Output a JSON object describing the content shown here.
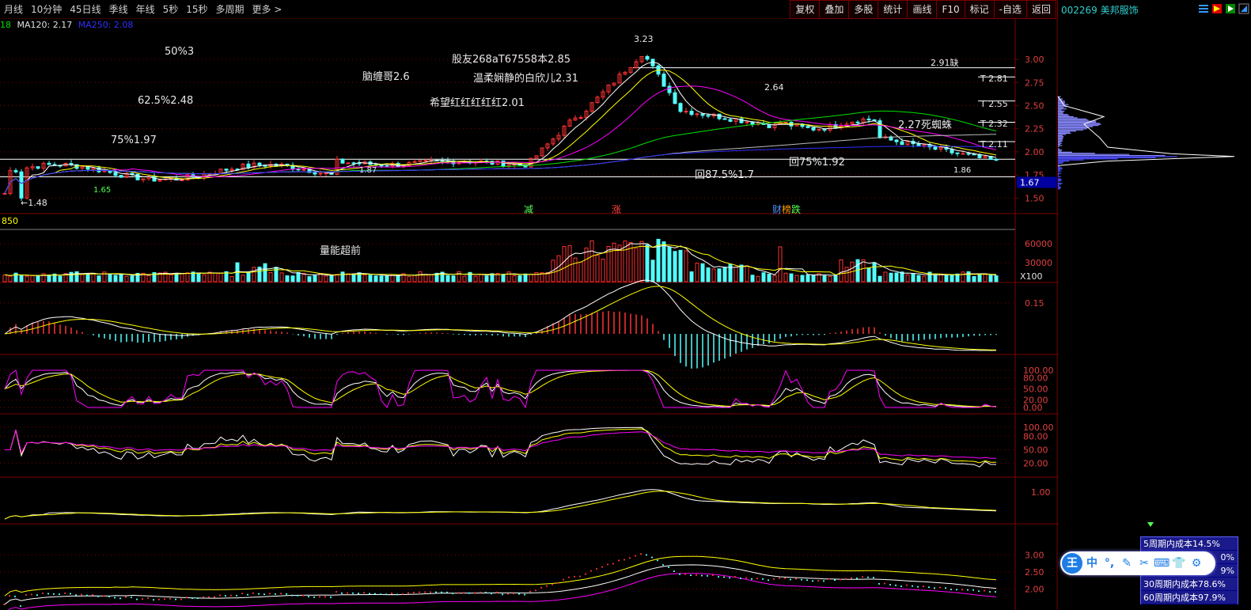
{
  "topbar": {
    "periods": [
      "月线",
      "10分钟",
      "45日线",
      "季线",
      "年线",
      "5秒",
      "15秒",
      "多周期",
      "更多 >"
    ],
    "buttons": [
      "复权",
      "叠加",
      "多股",
      "统计",
      "画线",
      "F10",
      "标记",
      "-自选",
      "返回"
    ]
  },
  "stock": {
    "code_name": "002269 美邦服饰"
  },
  "ma_legend": {
    "p1": "18",
    "p2": "MA120: 2.17",
    "p3": "MA250: 2.08"
  },
  "volume_label": "850",
  "x100": "X100",
  "price_axis": [
    "3.00",
    "2.75",
    "2.50",
    "2.25",
    "2.00",
    "1.75",
    "1.50"
  ],
  "current_price_tag": "1.67",
  "volume_axis": [
    "60000",
    "30000"
  ],
  "macd_axis": [
    "0.15"
  ],
  "kdj_axis": [
    "100.00",
    "80.00",
    "50.00",
    "20.00",
    "0.00"
  ],
  "rsi_axis": [
    "100.00",
    "80.00",
    "50.00",
    "20.00"
  ],
  "ind5_axis": [
    "1.00"
  ],
  "ind6_axis": [
    "3.00",
    "2.50",
    "2.00"
  ],
  "annotations": {
    "a1": "50%3",
    "a2": "62.5%2.48",
    "a3": "75%1.97",
    "a4": "脑缠哥2.6",
    "a5": "股友268aT67558本2.85",
    "a6": "温柔娴静的白欣儿2.31",
    "a7": "希望红红红红红2.01",
    "a8": "3.23",
    "a9": "2.91缺",
    "a10": "T 2.81",
    "a11": "2.64",
    "a12": "T 2.55",
    "a13": "T 2.32",
    "a14": "2.27死蜘蛛",
    "a15": "T 2.11",
    "a16": "回75%1.92",
    "a17": "回87.5%1.7",
    "a18": "1.86",
    "a19": "1.87",
    "a20": "1.65",
    "a21": "←1.48",
    "a22": "量能超前",
    "m1": "减",
    "m2": "涨",
    "m3": "财",
    "m4": "榜",
    "m5": "跌"
  },
  "cost_box": [
    "5周期内成本14.5%",
    "0%",
    "9%",
    "30周期内成本78.6%",
    "60周期内成本97.9%"
  ],
  "colors": {
    "up": "#ff3232",
    "down": "#54ffff",
    "ma_white": "#ffffff",
    "ma_yellow": "#ffff00",
    "ma_magenta": "#ff00ff",
    "ma_green": "#00e000",
    "ma_blue": "#3030ff",
    "grid": "#7a0000"
  }
}
